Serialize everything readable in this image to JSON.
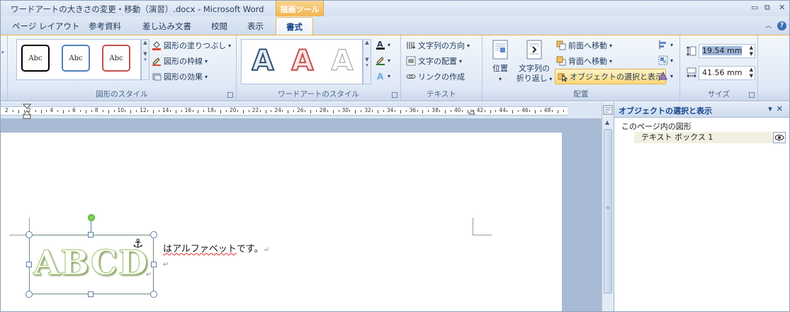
{
  "window": {
    "title": "ワードアートの大きさの変更・移動（演習）.docx - Microsoft Word",
    "contextual_tab": "描画ツール"
  },
  "tabs": [
    {
      "label": "ページ レイアウト"
    },
    {
      "label": "参考資料"
    },
    {
      "label": "差し込み文書"
    },
    {
      "label": "校閲"
    },
    {
      "label": "表示"
    },
    {
      "label": "書式",
      "active": true
    }
  ],
  "ribbon": {
    "shape_styles": {
      "label": "図形のスタイル",
      "samples": [
        "Abc",
        "Abc",
        "Abc"
      ],
      "fill": "図形の塗りつぶし",
      "outline": "図形の枠線",
      "effect": "図形の効果"
    },
    "wordart_styles": {
      "label": "ワードアートのスタイル",
      "letters": [
        "A",
        "A",
        "A"
      ]
    },
    "text": {
      "label": "テキスト",
      "direction": "文字列の方向",
      "align": "文字の配置",
      "link": "リンクの作成"
    },
    "arrange": {
      "label": "配置",
      "position": "位置",
      "wrap_line1": "文字列の",
      "wrap_line2": "折り返し",
      "bring_forward": "前面へ移動",
      "send_backward": "背面へ移動",
      "selection_pane": "オブジェクトの選択と表示"
    },
    "size": {
      "label": "サイズ",
      "height": "19.54 mm",
      "width": "41.56 mm"
    }
  },
  "ruler": {
    "numbers": [
      "2",
      "2",
      "4",
      "6",
      "8",
      "10",
      "12",
      "14",
      "16",
      "18",
      "20",
      "22",
      "24",
      "26",
      "28",
      "30",
      "32",
      "34",
      "36",
      "38",
      "40",
      "42",
      "44",
      "46",
      "48"
    ]
  },
  "document": {
    "wordart_text": "ABCD",
    "sentence_squiggle": "はアルファベット",
    "sentence_rest": "です。"
  },
  "pane": {
    "title": "オブジェクトの選択と表示",
    "subheading": "このページ内の図形",
    "items": [
      {
        "label": "テキスト ボックス 1"
      }
    ]
  },
  "colors": {
    "accent_tab": "#f2b452",
    "wordart_outline": "#9ec06a",
    "rotate_handle": "#7ed04a"
  }
}
